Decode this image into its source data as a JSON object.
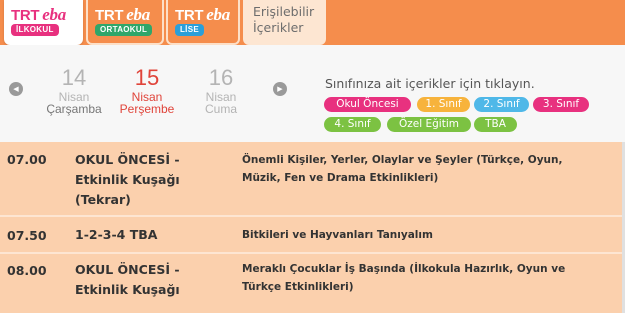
{
  "tabs": [
    {
      "brand": "TRT",
      "script": "eba",
      "badge": "İLKOKUL",
      "badge_color": "#e8317f",
      "active": true
    },
    {
      "brand": "TRT",
      "script": "eba",
      "badge": "ORTAOKUL",
      "badge_color": "#2fa66a",
      "active": false
    },
    {
      "brand": "TRT",
      "script": "eba",
      "badge": "LİSE",
      "badge_color": "#2b9fd9",
      "active": false
    }
  ],
  "accessible_tab": {
    "line1": "Erişilebilir",
    "line2": "İçerikler"
  },
  "days": [
    {
      "num": "14",
      "month": "Nisan",
      "weekday": "Çarşamba"
    },
    {
      "num": "15",
      "month": "Nisan",
      "weekday": "Perşembe",
      "selected": true
    },
    {
      "num": "16",
      "month": "Nisan",
      "weekday": "Cuma"
    }
  ],
  "instruction": "Sınıfınıza ait içerikler için tıklayın.",
  "classes": [
    {
      "label": "Okul Öncesi",
      "color": "#e8317f"
    },
    {
      "label": "1. Sınıf",
      "color": "#f7b33c"
    },
    {
      "label": "2. Sınıf",
      "color": "#4fb8e8"
    },
    {
      "label": "3. Sınıf",
      "color": "#e8317f"
    },
    {
      "label": "4. Sınıf",
      "color": "#7cc242"
    },
    {
      "label": "Özel Eğitim",
      "color": "#7cc242"
    },
    {
      "label": "TBA",
      "color": "#7cc242"
    }
  ],
  "schedule": [
    {
      "time": "07.00",
      "program": "OKUL ÖNCESİ - Etkinlik Kuşağı (Tekrar)",
      "description": "Önemli Kişiler, Yerler, Olaylar ve Şeyler (Türkçe, Oyun, Müzik, Fen ve Drama Etkinlikleri)"
    },
    {
      "time": "07.50",
      "program": "1-2-3-4 TBA",
      "description": "Bitkileri ve Hayvanları Tanıyalım"
    },
    {
      "time": "08.00",
      "program": "OKUL ÖNCESİ - Etkinlik Kuşağı",
      "description": "Meraklı Çocuklar İş Başında (İlkokula Hazırlık, Oyun ve Türkçe Etkinlikleri)"
    }
  ],
  "icons": {
    "prev": "chevron-left-icon",
    "next": "chevron-right-icon"
  }
}
